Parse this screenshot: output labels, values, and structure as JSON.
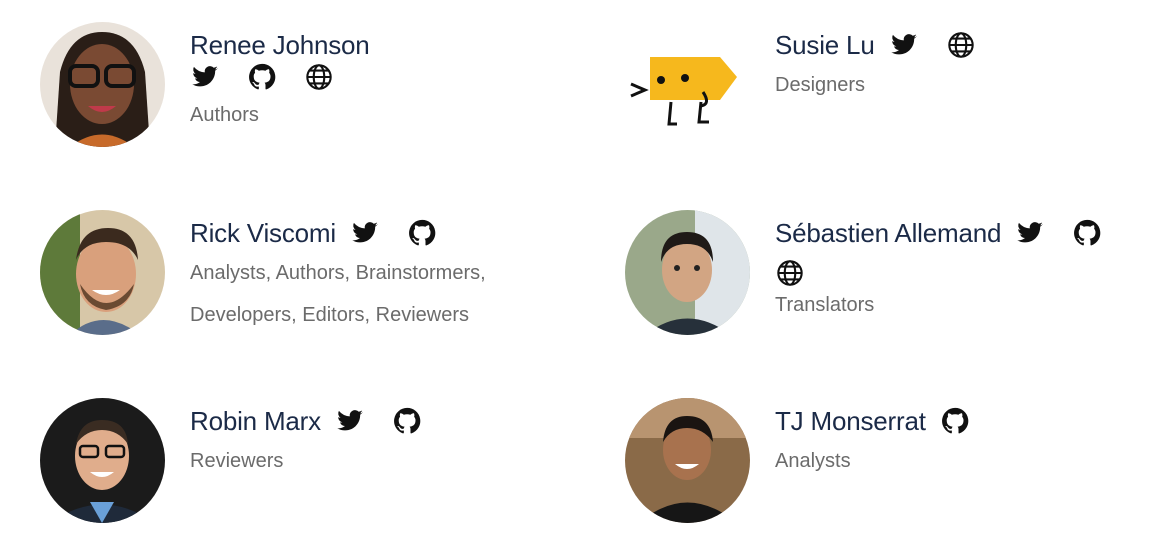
{
  "contributors": [
    {
      "name": "Renee Johnson",
      "roles": "Authors",
      "links": [
        "twitter-icon",
        "github-icon",
        "globe-icon"
      ]
    },
    {
      "name": "Susie Lu",
      "roles": "Designers",
      "links": [
        "twitter-icon",
        "globe-icon"
      ]
    },
    {
      "name": "Rick Viscomi",
      "roles": "Analysts, Authors, Brainstormers, Developers, Editors, Reviewers",
      "links": [
        "twitter-icon",
        "github-icon"
      ]
    },
    {
      "name": "Sébastien Allemand",
      "roles": "Translators",
      "links": [
        "twitter-icon",
        "github-icon",
        "globe-icon"
      ]
    },
    {
      "name": "Robin Marx",
      "roles": "Reviewers",
      "links": [
        "twitter-icon",
        "github-icon"
      ]
    },
    {
      "name": "TJ Monserrat",
      "roles": "Analysts",
      "links": [
        "github-icon"
      ]
    }
  ],
  "colors": {
    "name": "#1b2a47",
    "roles": "#6b6b6b",
    "icon": "#111111"
  }
}
